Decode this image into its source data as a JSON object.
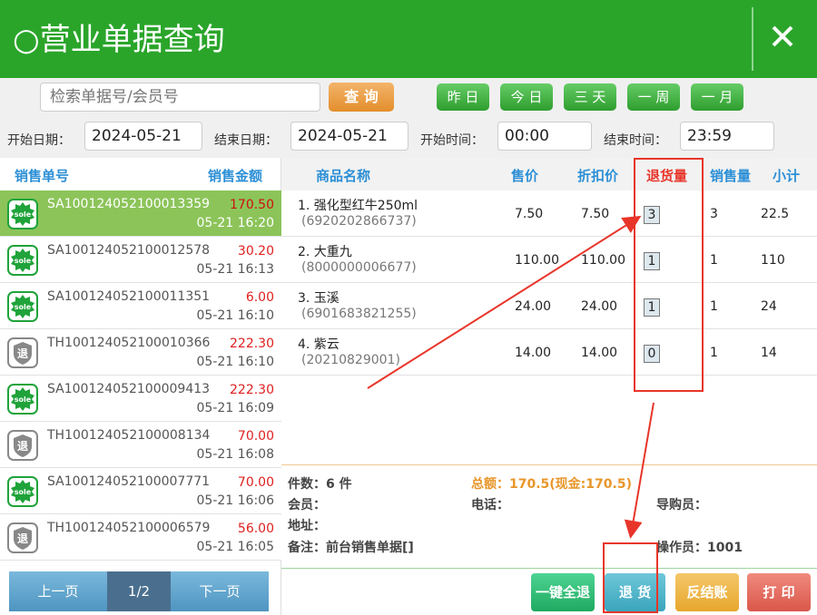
{
  "header": {
    "title": "○营业单据查询",
    "close_symbol": "✕"
  },
  "search": {
    "placeholder": "检索单据号/会员号",
    "query_label": "查 询"
  },
  "quick_ranges": [
    "昨 日",
    "今 日",
    "三 天",
    "一 周",
    "一 月"
  ],
  "filters": {
    "start_date_label": "开始日期：",
    "start_date": "2024-05-21",
    "end_date_label": "结束日期：",
    "end_date": "2024-05-21",
    "start_time_label": "开始时间：",
    "start_time": "00:00",
    "end_time_label": "结束时间：",
    "end_time": "23:59"
  },
  "orders_list": {
    "headers": [
      "销售单号",
      "销售金额"
    ],
    "items": [
      {
        "type": "sale",
        "number": "SA100124052100013359",
        "amount": "170.50",
        "time": "05-21 16:20",
        "selected": true
      },
      {
        "type": "sale",
        "number": "SA100124052100012578",
        "amount": "30.20",
        "time": "05-21 16:13"
      },
      {
        "type": "sale",
        "number": "SA100124052100011351",
        "amount": "6.00",
        "time": "05-21 16:10"
      },
      {
        "type": "return",
        "number": "TH100124052100010366",
        "amount": "222.30",
        "time": "05-21 16:10"
      },
      {
        "type": "sale",
        "number": "SA100124052100009413",
        "amount": "222.30",
        "time": "05-21 16:09"
      },
      {
        "type": "return",
        "number": "TH100124052100008134",
        "amount": "70.00",
        "time": "05-21 16:08"
      },
      {
        "type": "sale",
        "number": "SA100124052100007771",
        "amount": "70.00",
        "time": "05-21 16:06"
      },
      {
        "type": "return",
        "number": "TH100124052100006579",
        "amount": "56.00",
        "time": "05-21 16:05"
      }
    ],
    "icon_text_sale": "sole",
    "icon_text_return": "退",
    "pager": {
      "prev": "上一页",
      "page": "1/2",
      "next": "下一页"
    }
  },
  "detail": {
    "headers": [
      "商品名称",
      "售价",
      "折扣价",
      "退货量",
      "销售量",
      "小计"
    ],
    "rows": [
      {
        "name": "1. 强化型红牛250ml",
        "code": "(6920202866737)",
        "price": "7.50",
        "discount": "7.50",
        "return_qty": "3",
        "sale_qty": "3",
        "subtotal": "22.5"
      },
      {
        "name": "2. 大重九",
        "code": "(8000000006677)",
        "price": "110.00",
        "discount": "110.00",
        "return_qty": "1",
        "sale_qty": "1",
        "subtotal": "110"
      },
      {
        "name": "3. 玉溪",
        "code": "(6901683821255)",
        "price": "24.00",
        "discount": "24.00",
        "return_qty": "1",
        "sale_qty": "1",
        "subtotal": "24"
      },
      {
        "name": "4. 紫云",
        "code": "(20210829001)",
        "price": "14.00",
        "discount": "14.00",
        "return_qty": "0",
        "sale_qty": "1",
        "subtotal": "14"
      }
    ]
  },
  "summary": {
    "count": "件数：6 件",
    "total": "总额：170.5(现金:170.5)",
    "member": "会员：",
    "phone": "电话：",
    "guide": "导购员：",
    "address": "地址：",
    "note": "备注：前台销售单据[]",
    "operator": "操作员：1001"
  },
  "actions": {
    "return_all": "一键全退",
    "return": "退 货",
    "unsettle": "反结账",
    "print": "打 印"
  },
  "colors": {
    "header_green": "#2aa52a",
    "sale_red": "#e02020",
    "blue_text": "#2c8fd6",
    "highlight_red": "#e8352a"
  }
}
